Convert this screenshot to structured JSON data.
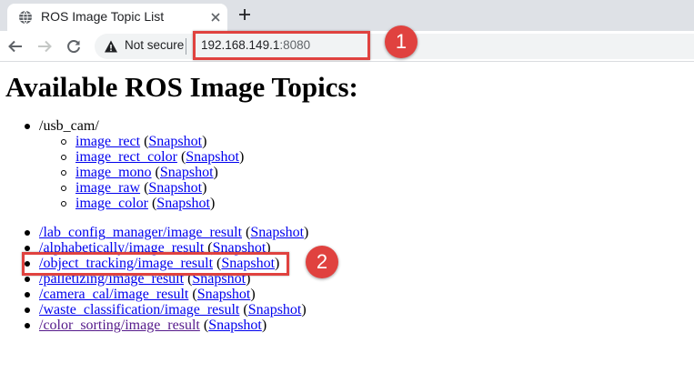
{
  "browser": {
    "tab_title": "ROS Image Topic List",
    "security_label": "Not secure",
    "url_host": "192.168.149.1",
    "url_port": ":8080"
  },
  "page": {
    "title": "Available ROS Image Topics:",
    "usb_cam": {
      "label": "/usb_cam/",
      "topics": [
        {
          "name": "image_rect",
          "snapshot": "Snapshot"
        },
        {
          "name": "image_rect_color",
          "snapshot": "Snapshot"
        },
        {
          "name": "image_mono",
          "snapshot": "Snapshot"
        },
        {
          "name": "image_raw",
          "snapshot": "Snapshot"
        },
        {
          "name": "image_color",
          "snapshot": "Snapshot"
        }
      ]
    },
    "topics": [
      {
        "name": "/lab_config_manager/image_result",
        "snapshot": "Snapshot"
      },
      {
        "name": "/alphabetically/image_result",
        "snapshot": "Snapshot"
      },
      {
        "name": "/object_tracking/image_result",
        "snapshot": "Snapshot"
      },
      {
        "name": "/palletizing/image_result",
        "snapshot": "Snapshot"
      },
      {
        "name": "/camera_cal/image_result",
        "snapshot": "Snapshot"
      },
      {
        "name": "/waste_classification/image_result",
        "snapshot": "Snapshot"
      },
      {
        "name": "/color_sorting/image_result",
        "snapshot": "Snapshot"
      }
    ]
  },
  "annotations": {
    "badge_1": "1",
    "badge_2": "2",
    "color": "#e0423f"
  },
  "icons": [
    "globe-icon",
    "close-icon",
    "plus-icon",
    "back-arrow-icon",
    "forward-arrow-icon",
    "reload-icon",
    "warning-icon"
  ]
}
